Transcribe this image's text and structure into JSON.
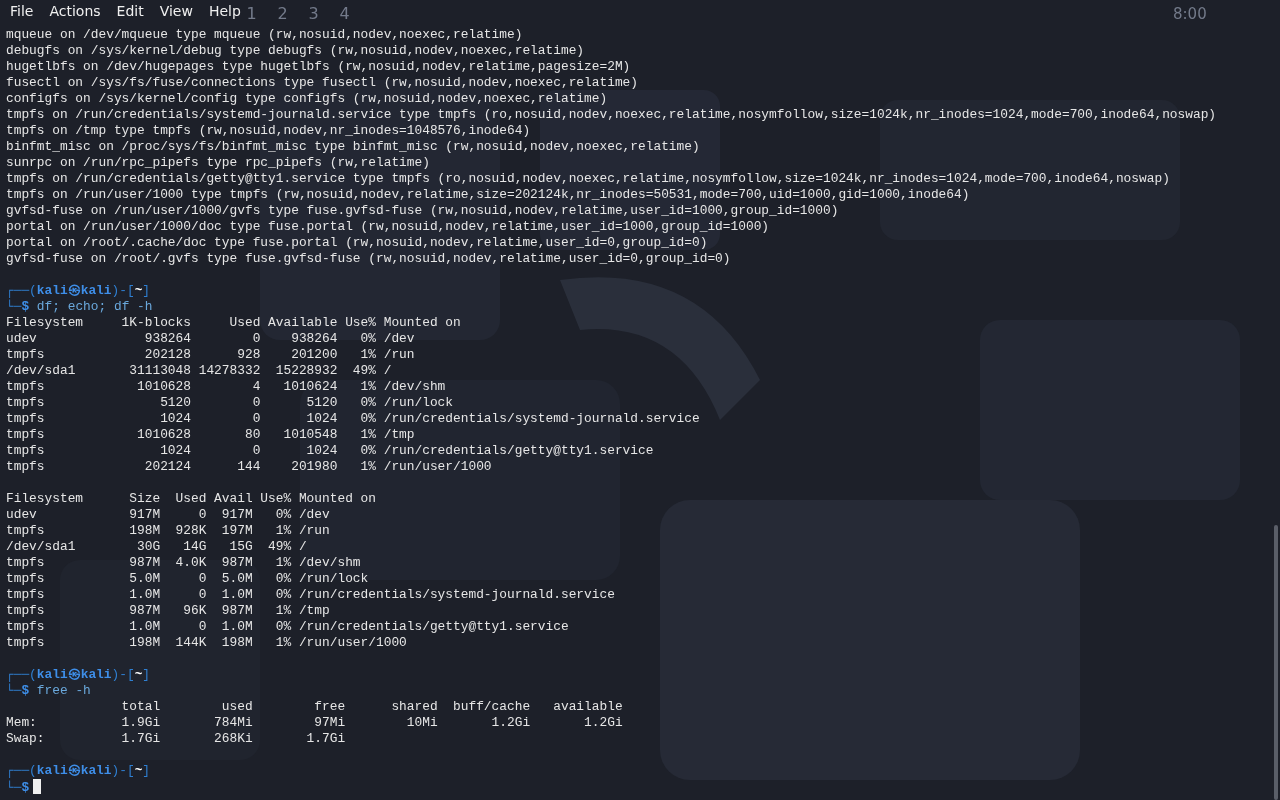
{
  "menu": [
    "File",
    "Actions",
    "Edit",
    "View",
    "Help"
  ],
  "panel": {
    "workspaces": [
      "1",
      "2",
      "3",
      "4"
    ],
    "clock": "8:00"
  },
  "terminal": {
    "lines": [
      {
        "kind": "output",
        "text": "mqueue on /dev/mqueue type mqueue (rw,nosuid,nodev,noexec,relatime)"
      },
      {
        "kind": "output",
        "text": "debugfs on /sys/kernel/debug type debugfs (rw,nosuid,nodev,noexec,relatime)"
      },
      {
        "kind": "output",
        "text": "hugetlbfs on /dev/hugepages type hugetlbfs (rw,nosuid,nodev,relatime,pagesize=2M)"
      },
      {
        "kind": "output",
        "text": "fusectl on /sys/fs/fuse/connections type fusectl (rw,nosuid,nodev,noexec,relatime)"
      },
      {
        "kind": "output",
        "text": "configfs on /sys/kernel/config type configfs (rw,nosuid,nodev,noexec,relatime)"
      },
      {
        "kind": "output",
        "text": "tmpfs on /run/credentials/systemd-journald.service type tmpfs (ro,nosuid,nodev,noexec,relatime,nosymfollow,size=1024k,nr_inodes=1024,mode=700,inode64,noswap)"
      },
      {
        "kind": "output",
        "text": "tmpfs on /tmp type tmpfs (rw,nosuid,nodev,nr_inodes=1048576,inode64)"
      },
      {
        "kind": "output",
        "text": "binfmt_misc on /proc/sys/fs/binfmt_misc type binfmt_misc (rw,nosuid,nodev,noexec,relatime)"
      },
      {
        "kind": "output",
        "text": "sunrpc on /run/rpc_pipefs type rpc_pipefs (rw,relatime)"
      },
      {
        "kind": "output",
        "text": "tmpfs on /run/credentials/getty@tty1.service type tmpfs (ro,nosuid,nodev,noexec,relatime,nosymfollow,size=1024k,nr_inodes=1024,mode=700,inode64,noswap)"
      },
      {
        "kind": "output",
        "text": "tmpfs on /run/user/1000 type tmpfs (rw,nosuid,nodev,relatime,size=202124k,nr_inodes=50531,mode=700,uid=1000,gid=1000,inode64)"
      },
      {
        "kind": "output",
        "text": "gvfsd-fuse on /run/user/1000/gvfs type fuse.gvfsd-fuse (rw,nosuid,nodev,relatime,user_id=1000,group_id=1000)"
      },
      {
        "kind": "output",
        "text": "portal on /run/user/1000/doc type fuse.portal (rw,nosuid,nodev,relatime,user_id=1000,group_id=1000)"
      },
      {
        "kind": "output",
        "text": "portal on /root/.cache/doc type fuse.portal (rw,nosuid,nodev,relatime,user_id=0,group_id=0)"
      },
      {
        "kind": "output",
        "text": "gvfsd-fuse on /root/.gvfs type fuse.gvfsd-fuse (rw,nosuid,nodev,relatime,user_id=0,group_id=0)"
      },
      {
        "kind": "blank"
      },
      {
        "kind": "prompt",
        "frame_open": "┌──(",
        "user": "kali",
        "separator": "㉿",
        "host": "kali",
        "path_open": ")-[",
        "cwd": "~",
        "path_close": "]",
        "input_marker": "└─$",
        "command": "df; echo; df -h",
        "cursor": false
      },
      {
        "kind": "output",
        "text": "Filesystem     1K-blocks     Used Available Use% Mounted on"
      },
      {
        "kind": "output",
        "text": "udev              938264        0    938264   0% /dev"
      },
      {
        "kind": "output",
        "text": "tmpfs             202128      928    201200   1% /run"
      },
      {
        "kind": "output",
        "text": "/dev/sda1       31113048 14278332  15228932  49% /"
      },
      {
        "kind": "output",
        "text": "tmpfs            1010628        4   1010624   1% /dev/shm"
      },
      {
        "kind": "output",
        "text": "tmpfs               5120        0      5120   0% /run/lock"
      },
      {
        "kind": "output",
        "text": "tmpfs               1024        0      1024   0% /run/credentials/systemd-journald.service"
      },
      {
        "kind": "output",
        "text": "tmpfs            1010628       80   1010548   1% /tmp"
      },
      {
        "kind": "output",
        "text": "tmpfs               1024        0      1024   0% /run/credentials/getty@tty1.service"
      },
      {
        "kind": "output",
        "text": "tmpfs             202124      144    201980   1% /run/user/1000"
      },
      {
        "kind": "blank"
      },
      {
        "kind": "output",
        "text": "Filesystem      Size  Used Avail Use% Mounted on"
      },
      {
        "kind": "output",
        "text": "udev            917M     0  917M   0% /dev"
      },
      {
        "kind": "output",
        "text": "tmpfs           198M  928K  197M   1% /run"
      },
      {
        "kind": "output",
        "text": "/dev/sda1        30G   14G   15G  49% /"
      },
      {
        "kind": "output",
        "text": "tmpfs           987M  4.0K  987M   1% /dev/shm"
      },
      {
        "kind": "output",
        "text": "tmpfs           5.0M     0  5.0M   0% /run/lock"
      },
      {
        "kind": "output",
        "text": "tmpfs           1.0M     0  1.0M   0% /run/credentials/systemd-journald.service"
      },
      {
        "kind": "output",
        "text": "tmpfs           987M   96K  987M   1% /tmp"
      },
      {
        "kind": "output",
        "text": "tmpfs           1.0M     0  1.0M   0% /run/credentials/getty@tty1.service"
      },
      {
        "kind": "output",
        "text": "tmpfs           198M  144K  198M   1% /run/user/1000"
      },
      {
        "kind": "blank"
      },
      {
        "kind": "prompt",
        "frame_open": "┌──(",
        "user": "kali",
        "separator": "㉿",
        "host": "kali",
        "path_open": ")-[",
        "cwd": "~",
        "path_close": "]",
        "input_marker": "└─$",
        "command": "free -h",
        "cursor": false
      },
      {
        "kind": "output",
        "text": "               total        used        free      shared  buff/cache   available"
      },
      {
        "kind": "output",
        "text": "Mem:           1.9Gi       784Mi        97Mi        10Mi       1.2Gi       1.2Gi"
      },
      {
        "kind": "output",
        "text": "Swap:          1.7Gi       268Ki       1.7Gi"
      },
      {
        "kind": "blank"
      },
      {
        "kind": "prompt",
        "frame_open": "┌──(",
        "user": "kali",
        "separator": "㉿",
        "host": "kali",
        "path_open": ")-[",
        "cwd": "~",
        "path_close": "]",
        "input_marker": "└─$",
        "cursor": true
      }
    ]
  }
}
